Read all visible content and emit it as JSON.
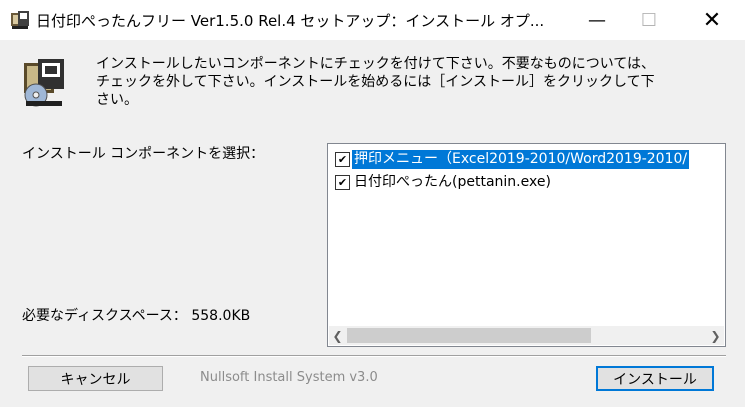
{
  "window": {
    "title": "日付印ぺったんフリー Ver1.5.0 Rel.4 セットアップ：インストール オプ...",
    "controls": {
      "minimize": "—",
      "maximize": "☐",
      "close": "✕"
    }
  },
  "description": "インストールしたいコンポーネントにチェックを付けて下さい。不要なものについては、\nチェックを外して下さい。インストールを始めるには［インストール］をクリックして下\nさい。",
  "select_label": "インストール コンポーネントを選択：",
  "components": [
    {
      "label": "押印メニュー（Excel2019-2010/Word2019-2010/",
      "checked": true,
      "selected": true
    },
    {
      "label": "日付印ぺったん(pettanin.exe)",
      "checked": true,
      "selected": false
    }
  ],
  "disk_space_label": "必要なディスクスペース： 558.0KB",
  "buttons": {
    "cancel": "キャンセル",
    "install": "インストール"
  },
  "branding": "Nullsoft Install System v3.0",
  "colors": {
    "selection": "#0078d7",
    "background": "#f0f0f0"
  }
}
